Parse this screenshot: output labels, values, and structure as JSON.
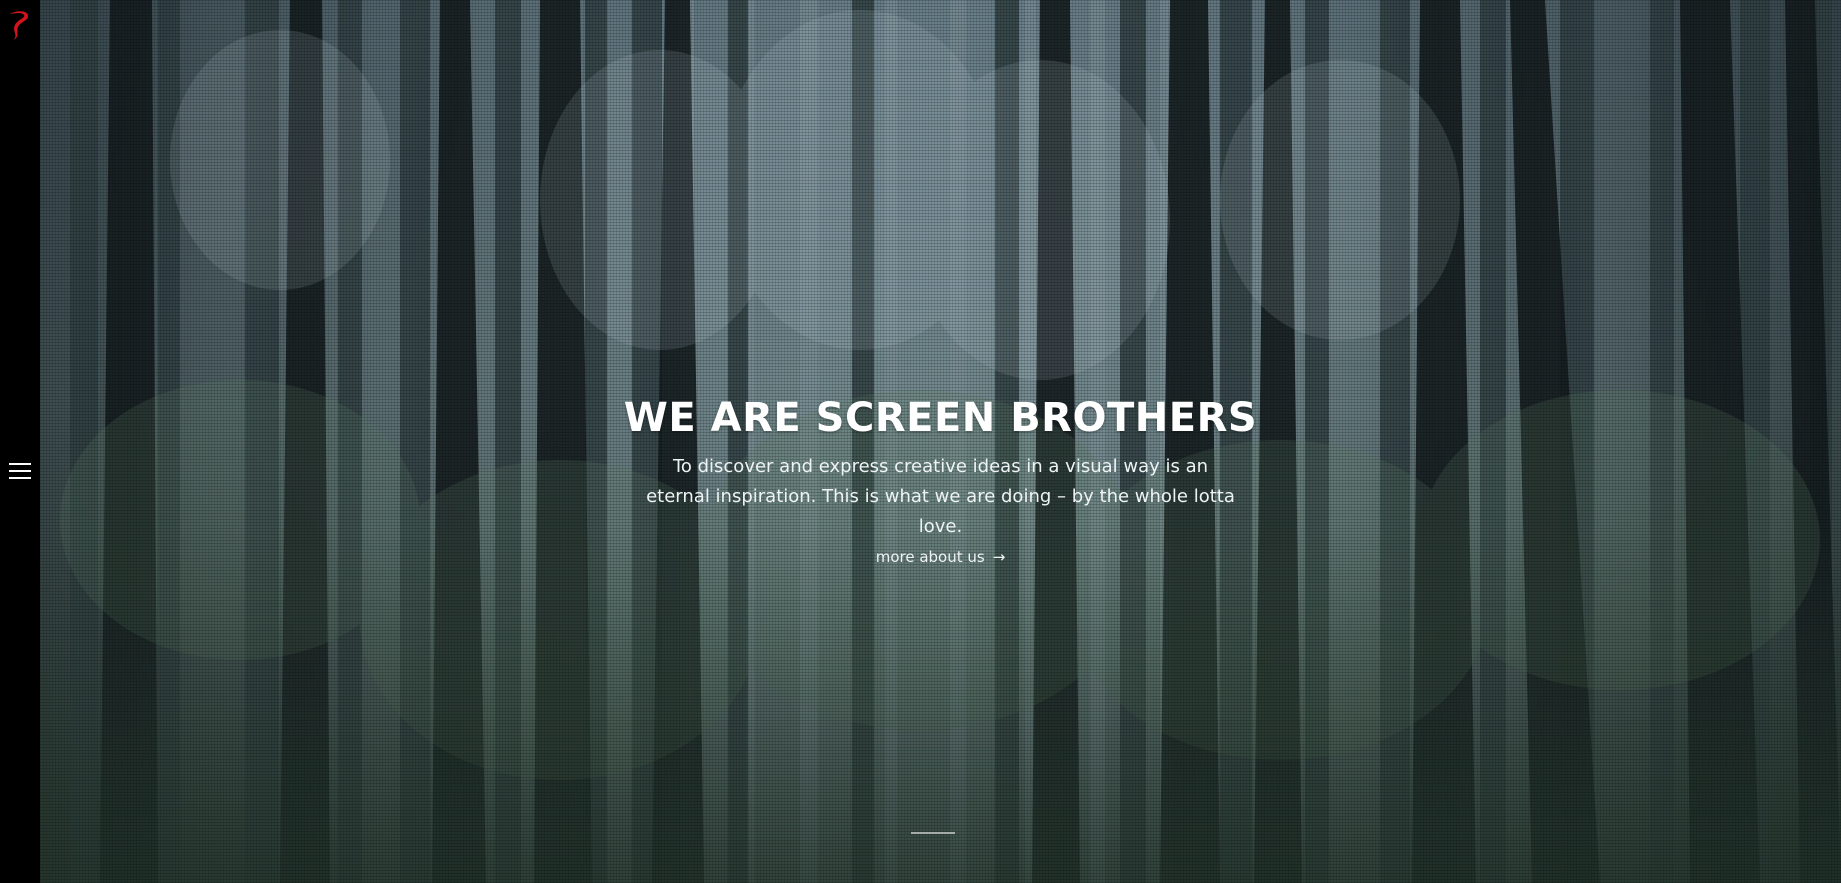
{
  "hero": {
    "title": "WE ARE SCREEN BROTHERS",
    "lead": "To discover and express creative ideas in a visual way is an eternal inspiration. This is what we are doing – by the whole lotta love.",
    "more_label": "more about us",
    "more_arrow": "→"
  },
  "icons": {
    "logo": "screen-brothers-logo",
    "menu": "hamburger-menu-icon",
    "more_arrow": "arrow-right-icon"
  },
  "colors": {
    "logo_red": "#d4141c",
    "sidebar": "#000000",
    "text": "#ffffff"
  }
}
